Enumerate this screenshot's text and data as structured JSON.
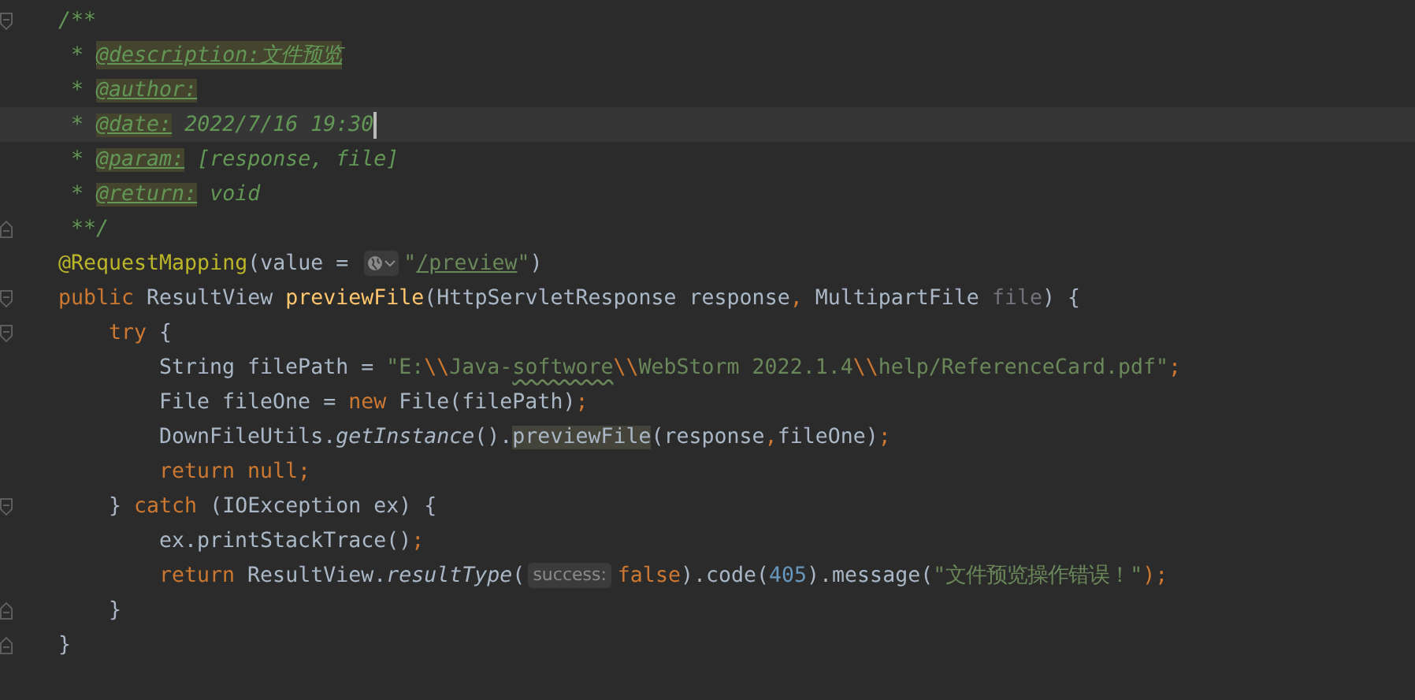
{
  "editor": {
    "lines": [
      {
        "kind": "top",
        "fold_start": true,
        "fold_end": false,
        "caret": false,
        "tokens": [
          {
            "text": "/**",
            "kind": "comment"
          }
        ]
      },
      {
        "kind": "doc",
        "fold_start": false,
        "fold_end": false,
        "caret": false,
        "tokens": [
          {
            "text": "* ",
            "kind": "comment"
          },
          {
            "text": "@description:文件预览",
            "kind": "doctag"
          }
        ]
      },
      {
        "kind": "doc",
        "fold_start": false,
        "fold_end": false,
        "caret": false,
        "tokens": [
          {
            "text": "* ",
            "kind": "comment"
          },
          {
            "text": "@author:",
            "kind": "doctag"
          }
        ]
      },
      {
        "kind": "doc",
        "fold_start": false,
        "fold_end": false,
        "caret": true,
        "tokens": [
          {
            "text": "* ",
            "kind": "comment"
          },
          {
            "text": "@date:",
            "kind": "doctag"
          },
          {
            "text": " 2022/7/16 19:30",
            "kind": "comment"
          }
        ]
      },
      {
        "kind": "doc",
        "fold_start": false,
        "fold_end": false,
        "caret": false,
        "tokens": [
          {
            "text": "* ",
            "kind": "comment"
          },
          {
            "text": "@param:",
            "kind": "doctag"
          },
          {
            "text": " [response, file]",
            "kind": "comment"
          }
        ]
      },
      {
        "kind": "doc",
        "fold_start": false,
        "fold_end": false,
        "caret": false,
        "tokens": [
          {
            "text": "* ",
            "kind": "comment"
          },
          {
            "text": "@return:",
            "kind": "doctag"
          },
          {
            "text": " void",
            "kind": "comment"
          }
        ]
      },
      {
        "kind": "doc",
        "fold_start": false,
        "fold_end": true,
        "caret": false,
        "tokens": [
          {
            "text": "**/",
            "kind": "comment"
          }
        ]
      },
      {
        "kind": "top",
        "fold_start": false,
        "fold_end": false,
        "caret": false,
        "tokens": [
          {
            "text": "@RequestMapping",
            "kind": "annotation"
          },
          {
            "text": "(value = ",
            "kind": "plain"
          },
          {
            "kind": "globe-inlay"
          },
          {
            "text": "\"",
            "kind": "string"
          },
          {
            "text": "/preview",
            "kind": "link"
          },
          {
            "text": "\"",
            "kind": "string"
          },
          {
            "text": ")",
            "kind": "plain"
          }
        ]
      },
      {
        "kind": "top",
        "fold_start": true,
        "fold_end": false,
        "caret": false,
        "tokens": [
          {
            "text": "public ",
            "kind": "keyword"
          },
          {
            "text": "ResultView ",
            "kind": "plain"
          },
          {
            "text": "previewFile",
            "kind": "method"
          },
          {
            "text": "(HttpServletResponse response",
            "kind": "plain"
          },
          {
            "text": ", ",
            "kind": "keyword"
          },
          {
            "text": "MultipartFile ",
            "kind": "plain"
          },
          {
            "text": "file",
            "kind": "unused"
          },
          {
            "text": ") {",
            "kind": "plain"
          }
        ]
      },
      {
        "kind": "body",
        "fold_start": true,
        "fold_end": false,
        "caret": false,
        "tokens": [
          {
            "text": "try ",
            "kind": "keyword"
          },
          {
            "text": "{",
            "kind": "plain"
          }
        ]
      },
      {
        "kind": "nested",
        "fold_start": false,
        "fold_end": false,
        "caret": false,
        "tokens": [
          {
            "text": "String filePath = ",
            "kind": "plain"
          },
          {
            "text": "\"E:",
            "kind": "string"
          },
          {
            "text": "\\\\",
            "kind": "escape"
          },
          {
            "text": "Java-",
            "kind": "string"
          },
          {
            "text": "softwore",
            "kind": "typo"
          },
          {
            "text": "\\\\",
            "kind": "escape"
          },
          {
            "text": "WebStorm 2022.1.4",
            "kind": "string"
          },
          {
            "text": "\\\\",
            "kind": "escape"
          },
          {
            "text": "help/ReferenceCard.pdf\"",
            "kind": "string"
          },
          {
            "text": ";",
            "kind": "keyword"
          }
        ]
      },
      {
        "kind": "nested",
        "fold_start": false,
        "fold_end": false,
        "caret": false,
        "tokens": [
          {
            "text": "File fileOne = ",
            "kind": "plain"
          },
          {
            "text": "new ",
            "kind": "keyword"
          },
          {
            "text": "File(filePath)",
            "kind": "plain"
          },
          {
            "text": ";",
            "kind": "keyword"
          }
        ]
      },
      {
        "kind": "nested",
        "fold_start": false,
        "fold_end": false,
        "caret": false,
        "tokens": [
          {
            "text": "DownFileUtils.",
            "kind": "plain"
          },
          {
            "text": "getInstance",
            "kind": "static"
          },
          {
            "text": "().",
            "kind": "plain"
          },
          {
            "text": "previewFile",
            "kind": "usage"
          },
          {
            "text": "(response",
            "kind": "plain"
          },
          {
            "text": ",",
            "kind": "keyword"
          },
          {
            "text": "fileOne)",
            "kind": "plain"
          },
          {
            "text": ";",
            "kind": "keyword"
          }
        ]
      },
      {
        "kind": "nested",
        "fold_start": false,
        "fold_end": false,
        "caret": false,
        "tokens": [
          {
            "text": "return null;",
            "kind": "keyword"
          }
        ]
      },
      {
        "kind": "body",
        "fold_start": true,
        "fold_end": false,
        "caret": false,
        "tokens": [
          {
            "text": "} ",
            "kind": "plain"
          },
          {
            "text": "catch ",
            "kind": "keyword"
          },
          {
            "text": "(IOException ex) {",
            "kind": "plain"
          }
        ]
      },
      {
        "kind": "nested",
        "fold_start": false,
        "fold_end": false,
        "caret": false,
        "tokens": [
          {
            "text": "ex.printStackTrace()",
            "kind": "plain"
          },
          {
            "text": ";",
            "kind": "keyword"
          }
        ]
      },
      {
        "kind": "nested",
        "fold_start": false,
        "fold_end": false,
        "caret": false,
        "tokens": [
          {
            "text": "return ",
            "kind": "keyword"
          },
          {
            "text": "ResultView.",
            "kind": "plain"
          },
          {
            "text": "resultType",
            "kind": "static"
          },
          {
            "text": "(",
            "kind": "plain"
          },
          {
            "text": "success:",
            "kind": "hint"
          },
          {
            "text": "false",
            "kind": "keyword"
          },
          {
            "text": ").code(",
            "kind": "plain"
          },
          {
            "text": "405",
            "kind": "number"
          },
          {
            "text": ").message(",
            "kind": "plain"
          },
          {
            "text": "\"文件预览操作错误！\"",
            "kind": "string"
          },
          {
            "text": ");",
            "kind": "semi"
          }
        ]
      },
      {
        "kind": "body",
        "fold_start": false,
        "fold_end": true,
        "caret": false,
        "tokens": [
          {
            "text": "}",
            "kind": "plain"
          }
        ]
      },
      {
        "kind": "top",
        "fold_start": false,
        "fold_end": true,
        "caret": false,
        "tokens": [
          {
            "text": "}",
            "kind": "plain"
          }
        ]
      }
    ]
  }
}
